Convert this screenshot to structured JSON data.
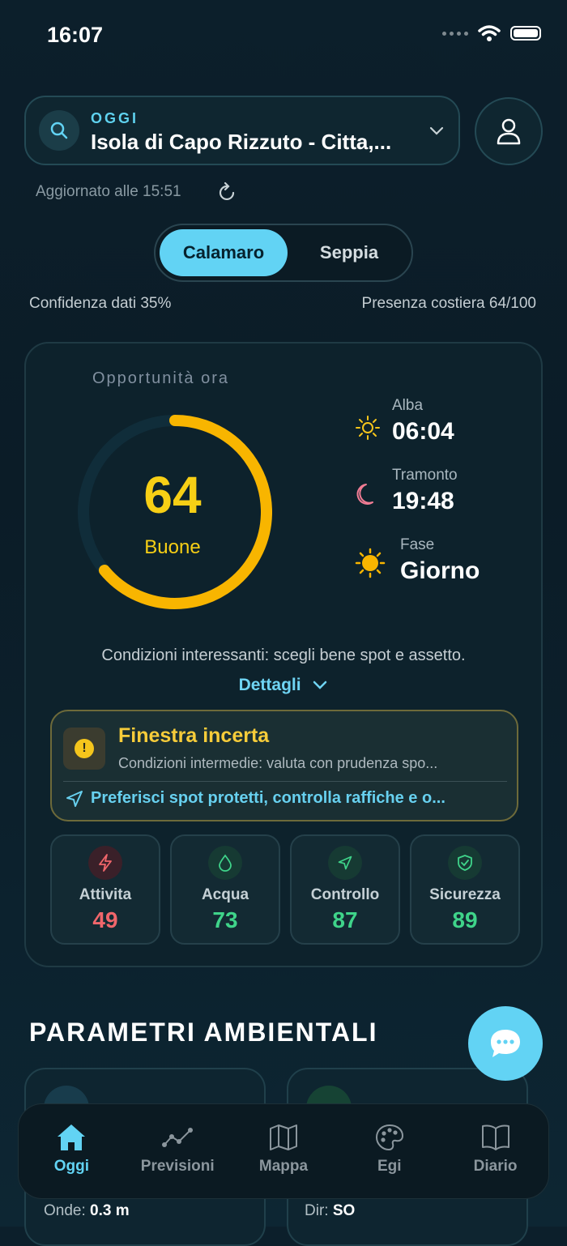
{
  "status": {
    "time": "16:07"
  },
  "header": {
    "day_label": "OGGI",
    "location": "Isola di Capo Rizzuto - Citta,...",
    "updated": "Aggiornato alle 15:51"
  },
  "species_tabs": {
    "active": "Calamaro",
    "inactive": "Seppia"
  },
  "stats": {
    "confidence": "Confidenza dati 35%",
    "presence": "Presenza costiera 64/100"
  },
  "opportunity": {
    "label": "Opportunità ora",
    "score": "64",
    "score_value": 64,
    "rating": "Buone",
    "gauge_color": "#f8b500"
  },
  "sun": {
    "sunrise_label": "Alba",
    "sunrise_value": "06:04",
    "sunset_label": "Tramonto",
    "sunset_value": "19:48",
    "phase_label": "Fase",
    "phase_value": "Giorno"
  },
  "conditions": {
    "text": "Condizioni interessanti: scegli bene spot e assetto.",
    "details_label": "Dettagli"
  },
  "warning": {
    "title": "Finestra incerta",
    "subtitle": "Condizioni intermedie: valuta con prudenza spo...",
    "tip": "Preferisci spot protetti, controlla raffiche e o..."
  },
  "metrics": [
    {
      "label": "Attivita",
      "value": "49",
      "color": "#f0666b",
      "icon": "lightning-icon"
    },
    {
      "label": "Acqua",
      "value": "73",
      "color": "#3fd48a",
      "icon": "drop-icon"
    },
    {
      "label": "Controllo",
      "value": "87",
      "color": "#3fd48a",
      "icon": "navigation-icon"
    },
    {
      "label": "Sicurezza",
      "value": "89",
      "color": "#3fd48a",
      "icon": "shield-icon"
    }
  ],
  "environment": {
    "title": "PARAMETRI AMBIENTALI",
    "left_label": "Onde:",
    "left_value": "0.3 m",
    "right_label": "Dir:",
    "right_value": "SO"
  },
  "tabs": [
    {
      "label": "Oggi",
      "active": true
    },
    {
      "label": "Previsioni",
      "active": false
    },
    {
      "label": "Mappa",
      "active": false
    },
    {
      "label": "Egi",
      "active": false
    },
    {
      "label": "Diario",
      "active": false
    }
  ]
}
